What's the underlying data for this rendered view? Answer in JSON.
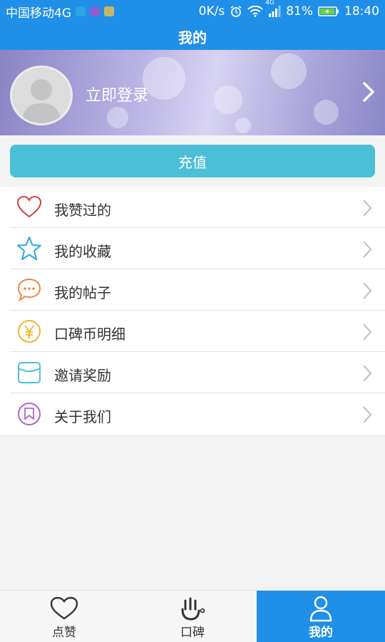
{
  "status_bar": {
    "carrier": "中国移动4G",
    "speed": "0K/s",
    "signal_type": "4G",
    "battery": "81%",
    "time": "18:40",
    "icons": [
      "message-notification-icon",
      "gallery-notification-icon",
      "app-notification-icon",
      "alarm-icon",
      "wifi-icon",
      "signal-icon",
      "battery-charging-icon"
    ]
  },
  "header": {
    "title": "我的"
  },
  "profile": {
    "login_text": "立即登录",
    "avatar_icon": "default-avatar-icon"
  },
  "recharge": {
    "label": "充值"
  },
  "menu": {
    "items": [
      {
        "label": "我赞过的",
        "icon": "heart-icon",
        "color": "#d93a3a"
      },
      {
        "label": "我的收藏",
        "icon": "star-icon",
        "color": "#2aa7e0"
      },
      {
        "label": "我的帖子",
        "icon": "speech-bubble-icon",
        "color": "#f08a3c"
      },
      {
        "label": "口碑币明细",
        "icon": "yen-coin-icon",
        "color": "#f0b52a"
      },
      {
        "label": "邀请奖励",
        "icon": "envelope-icon",
        "color": "#4bbfd6"
      },
      {
        "label": "关于我们",
        "icon": "bookmark-icon",
        "color": "#b065c9"
      }
    ]
  },
  "bottom_nav": {
    "tabs": [
      {
        "label": "点赞",
        "icon": "heart-outline-icon",
        "active": false
      },
      {
        "label": "口碑",
        "icon": "hand-pointer-icon",
        "active": false
      },
      {
        "label": "我的",
        "icon": "person-icon",
        "active": true
      }
    ]
  },
  "colors": {
    "primary": "#1f8fe8",
    "recharge": "#4bbfd6",
    "background": "#f3f3f3"
  }
}
